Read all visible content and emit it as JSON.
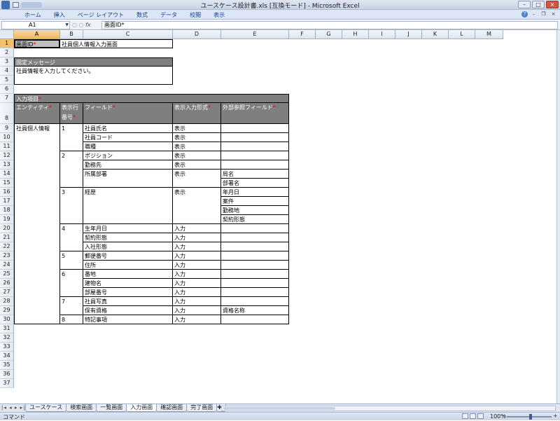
{
  "window": {
    "title": "ユースケース設計書.xls [互換モード] - Microsoft Excel"
  },
  "ribbon": {
    "tabs": [
      "ホーム",
      "挿入",
      "ページ レイアウト",
      "数式",
      "データ",
      "校閲",
      "表示"
    ]
  },
  "formula": {
    "name_box": "A1",
    "fx": "fx",
    "content": "画面ID*"
  },
  "columns": [
    "A",
    "B",
    "C",
    "D",
    "E",
    "F",
    "G",
    "H",
    "I",
    "J",
    "K",
    "L",
    "M"
  ],
  "rows": [
    "1",
    "2",
    "3",
    "4",
    "5",
    "6",
    "7",
    "8",
    "9",
    "10",
    "11",
    "12",
    "13",
    "14",
    "15",
    "16",
    "17",
    "18",
    "19",
    "20",
    "21",
    "22",
    "23",
    "24",
    "25",
    "26",
    "27",
    "28",
    "29",
    "30",
    "31",
    "32",
    "33",
    "34",
    "35",
    "36",
    "37"
  ],
  "sheet": {
    "screen_id_label": "画面ID",
    "screen_name": "社員個人情報入力画面",
    "fixed_msg_header": "固定メッセージ",
    "fixed_msg": "社員情報を入力してください。",
    "input_items_header": "入力項目",
    "h_entity": "エンティティ",
    "h_order_1": "表示行",
    "h_order_2": "番号",
    "h_field": "フィールド",
    "h_format": "表示入力形式",
    "h_extref": "外部参照フィールド",
    "req_mark": "*",
    "entity": "社員個人情報",
    "groups": [
      {
        "no": "1",
        "row_start": 9,
        "row_end": 11
      },
      {
        "no": "2",
        "row_start": 12,
        "row_end": 15
      },
      {
        "no": "3",
        "row_start": 16,
        "row_end": 19
      },
      {
        "no": "4",
        "row_start": 20,
        "row_end": 22
      },
      {
        "no": "5",
        "row_start": 23,
        "row_end": 24
      },
      {
        "no": "6",
        "row_start": 25,
        "row_end": 27
      },
      {
        "no": "7",
        "row_start": 28,
        "row_end": 29
      },
      {
        "no": "8",
        "row_start": 30,
        "row_end": 30
      }
    ],
    "fields": [
      {
        "row": 9,
        "field": "社員氏名",
        "format": "表示",
        "ref": ""
      },
      {
        "row": 10,
        "field": "社員コード",
        "format": "表示",
        "ref": ""
      },
      {
        "row": 11,
        "field": "職種",
        "format": "表示",
        "ref": ""
      },
      {
        "row": 12,
        "field": "ポジション",
        "format": "表示",
        "ref": ""
      },
      {
        "row": 13,
        "field": "勤務先",
        "format": "表示",
        "ref": ""
      },
      {
        "row": 14,
        "field": "所属部署",
        "format": "表示",
        "ref": "局名",
        "span": 2
      },
      {
        "row": 15,
        "field": "",
        "format": "",
        "ref": "部署名",
        "cont": true
      },
      {
        "row": 16,
        "field": "経歴",
        "format": "表示",
        "ref": "年月日",
        "span": 4
      },
      {
        "row": 17,
        "field": "",
        "format": "",
        "ref": "案件",
        "cont": true
      },
      {
        "row": 18,
        "field": "",
        "format": "",
        "ref": "勤務地",
        "cont": true
      },
      {
        "row": 19,
        "field": "",
        "format": "",
        "ref": "契約形態",
        "cont": true
      },
      {
        "row": 20,
        "field": "生年月日",
        "format": "入力",
        "ref": ""
      },
      {
        "row": 21,
        "field": "契約形態",
        "format": "入力",
        "ref": ""
      },
      {
        "row": 22,
        "field": "入社形態",
        "format": "入力",
        "ref": ""
      },
      {
        "row": 23,
        "field": "郵便番号",
        "format": "入力",
        "ref": ""
      },
      {
        "row": 24,
        "field": "住所",
        "format": "入力",
        "ref": ""
      },
      {
        "row": 25,
        "field": "番地",
        "format": "入力",
        "ref": ""
      },
      {
        "row": 26,
        "field": "建物名",
        "format": "入力",
        "ref": ""
      },
      {
        "row": 27,
        "field": "部屋番号",
        "format": "入力",
        "ref": ""
      },
      {
        "row": 28,
        "field": "社員写真",
        "format": "入力",
        "ref": ""
      },
      {
        "row": 29,
        "field": "保有資格",
        "format": "入力",
        "ref": "資格名称"
      },
      {
        "row": 30,
        "field": "特記事項",
        "format": "入力",
        "ref": ""
      }
    ]
  },
  "sheet_tabs": [
    "ユースケース",
    "検索画面",
    "一覧画面",
    "入力画面",
    "確認画面",
    "完了画面"
  ],
  "active_tab": "入力画面",
  "status": {
    "mode": "コマンド",
    "zoom": "100%",
    "zoom_minus": "−",
    "zoom_plus": "+"
  },
  "icons": {
    "nav": "sheet-nav-arrows",
    "close": "close-icon",
    "help": "help-icon"
  }
}
